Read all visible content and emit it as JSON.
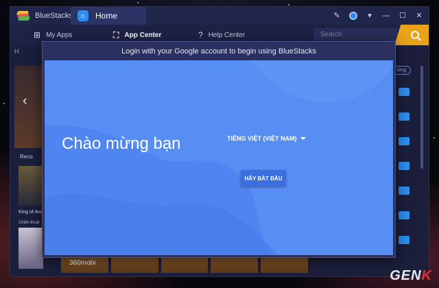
{
  "app": {
    "name": "BlueStacks"
  },
  "tab": {
    "label": "Home"
  },
  "window_controls": [
    "pin-icon",
    "account-icon",
    "menu-icon",
    "minimize-icon",
    "maximize-icon",
    "close-icon"
  ],
  "nav": {
    "items": [
      {
        "label": "My Apps",
        "icon": "grid-icon"
      },
      {
        "label": "App Center",
        "icon": "bag-icon",
        "active": true
      },
      {
        "label": "Help Center",
        "icon": "help-icon"
      }
    ],
    "search_placeholder": "Search"
  },
  "background": {
    "breadcrumb": "H",
    "recommended_label": "Reco",
    "game_title": "King of Ava",
    "game_subtitle": "Chiến thuật",
    "strip_label": "360mobi",
    "pill_label": "ding"
  },
  "modal": {
    "header": "Login with your Google account to begin using BlueStacks",
    "welcome": "Chào mừng bạn",
    "language": "TIẾNG VIỆT (VIỆT NAM)",
    "start_button": "HÃY BẮT ĐẦU"
  },
  "watermark": {
    "prefix": "GEN",
    "suffix": "K"
  },
  "colors": {
    "window_bg": "#1b1f3b",
    "modal_blue": "#4e85f0",
    "accent_orange": "#e8a31a",
    "download_blue": "#2e8ef0"
  }
}
